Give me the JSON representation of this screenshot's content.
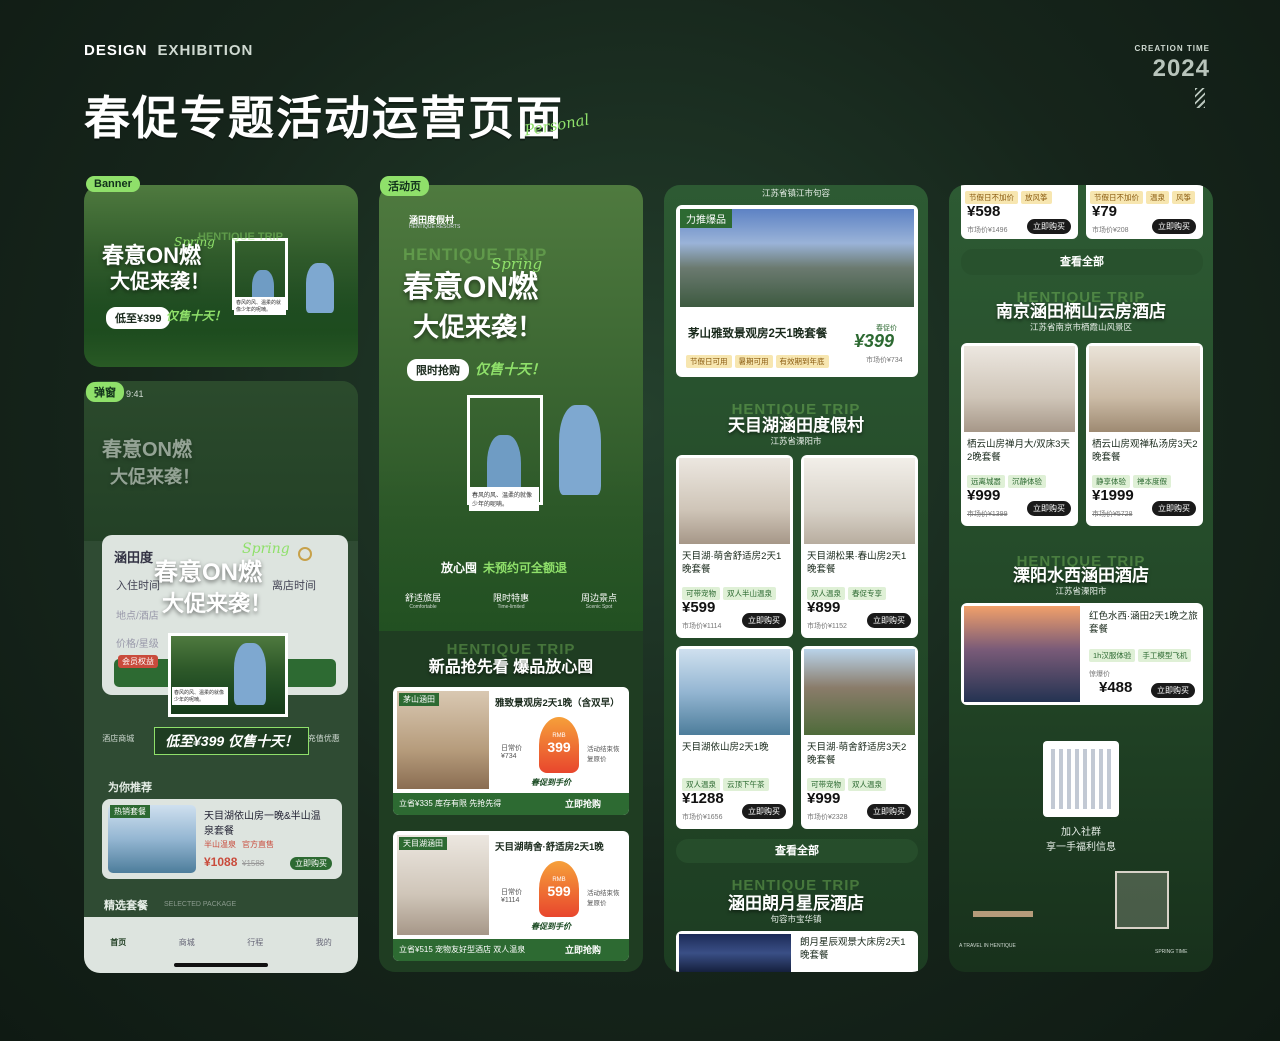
{
  "header": {
    "brand_a": "DESIGN",
    "brand_b": "EXHIBITION",
    "title": "春促专题活动运营页面",
    "script": "Personal",
    "creation_label": "CREATION TIME",
    "year": "2024"
  },
  "tags": {
    "banner": "Banner",
    "popup": "弹窗",
    "activity": "活动页"
  },
  "banner": {
    "trip": "HENTIQUE TRIP",
    "spring": "Spring",
    "line1": "春意ON燃",
    "line2": "大促来袭！",
    "price_pill": "低至¥399",
    "sale": "仅售十天！",
    "note": "春风的风、温柔的就像少年的呢喃。"
  },
  "popup": {
    "time": "9:41",
    "brand_row": "涵田度",
    "checkin": "入住时间",
    "checkout": "离店时间",
    "loc": "地点/酒店",
    "price": "价格/星级",
    "member": "会员权益",
    "icons": [
      "酒店商城",
      "加入社群",
      "最全攻略",
      "充值优惠"
    ],
    "rec_title": "为你推荐",
    "rec_tag": "热销套餐",
    "rec_name": "天目湖依山房一晚&半山温泉套餐",
    "rec_chips": [
      "半山温泉",
      "官方直售"
    ],
    "rec_price": "¥1088",
    "rec_old": "¥1588",
    "rec_buy": "立即购买",
    "pkg_title": "精选套餐",
    "pkg_en": "SELECTED PACKAGE",
    "nav": [
      "首页",
      "商城",
      "行程",
      "我的"
    ],
    "popup_price": "低至¥399 仅售十天！"
  },
  "activity": {
    "logo": "涵田度假村",
    "logo_en": "HENTIQUE RESORTS",
    "trip": "HENTIQUE TRIP",
    "spring": "Spring",
    "line1": "春意ON燃",
    "line2": "大促来袭！",
    "limited": "限时抢购",
    "sale": "仅售十天！",
    "note": "春风的风、温柔的就像少年的呢喃。",
    "slogan_a": "放心囤",
    "slogan_b": "未预约可全额退",
    "features": [
      {
        "zh": "舒适旅居",
        "en": "Comfortable"
      },
      {
        "zh": "限时特惠",
        "en": "Time-limited"
      },
      {
        "zh": "周边景点",
        "en": "Scenic Spot"
      }
    ],
    "new_title": "新品抢先看 爆品放心囤",
    "ghost": "HENTIQUE TRIP",
    "offers": [
      {
        "tag": "茅山涵田",
        "name": "雅致景观房2天1晚（含双早）",
        "daily": "日常价",
        "daily_val": "¥734",
        "rmb": "RMB",
        "price": "399",
        "end": "活动结束恢复原价",
        "hint": "春促到手价",
        "foot": "立省¥335 库存有限 先抢先得",
        "btn": "立即抢购"
      },
      {
        "tag": "天目湖涵田",
        "name": "天目湖萌舍·舒适房2天1晚",
        "daily": "日常价",
        "daily_val": "¥1114",
        "rmb": "RMB",
        "price": "599",
        "end": "活动结束恢复原价",
        "hint": "春促到手价",
        "foot": "立省¥515 宠物友好型酒店 双人温泉",
        "btn": "立即抢购"
      }
    ]
  },
  "col3": {
    "top_loc": "江苏省镇江市句容",
    "hot_tag": "力推爆品",
    "hot_name": "茅山雅致景观房2天1晚套餐",
    "hot_chips": [
      "节假日可用",
      "暑期可用",
      "有效期到年底"
    ],
    "spring_price_label": "春促价",
    "hot_price": "¥399",
    "hot_mk": "市场价¥734",
    "sec1_title": "天目湖涵田度假村",
    "sec1_loc": "江苏省溧阳市",
    "sec1_items": [
      {
        "name": "天目湖·萌舍舒适房2天1晚套餐",
        "chips": [
          "可带宠物",
          "双人半山温泉"
        ],
        "price": "¥599",
        "mk": "市场价¥1114",
        "buy": "立即购买"
      },
      {
        "name": "天目湖松果·春山房2天1晚套餐",
        "chips": [
          "双人温泉",
          "春促专享"
        ],
        "price": "¥899",
        "mk": "市场价¥1152",
        "buy": "立即购买"
      },
      {
        "name": "天目湖依山房2天1晚",
        "chips": [
          "双人温泉",
          "云顶下午茶"
        ],
        "price": "¥1288",
        "mk": "市场价¥1656",
        "buy": "立即购买"
      },
      {
        "name": "天目湖·萌舍舒适房3天2晚套餐",
        "chips": [
          "可带宠物",
          "双人温泉"
        ],
        "price": "¥999",
        "mk": "市场价¥2328",
        "buy": "立即购买"
      }
    ],
    "view_all": "查看全部",
    "sec2_title": "涵田朗月星辰酒店",
    "sec2_loc": "句容市宝华镇",
    "sec2_item": "朗月星辰观景大床房2天1晚套餐"
  },
  "col4": {
    "top_items": [
      {
        "chips": [
          "节假日不加价",
          "放风筝"
        ],
        "price": "¥598",
        "mk": "市场价¥1496",
        "buy": "立即购买"
      },
      {
        "chips": [
          "节假日不加价",
          "温泉",
          "风筝"
        ],
        "price": "¥79",
        "mk": "市场价¥208",
        "buy": "立即购买"
      }
    ],
    "view_all": "查看全部",
    "sec1_title": "南京涵田栖山云房酒店",
    "sec1_loc": "江苏省南京市栖霞山风景区",
    "sec1_items": [
      {
        "name": "栖云山房禅月大/双床3天2晚套餐",
        "chips": [
          "远离城嚣",
          "沉静体验"
        ],
        "price": "¥999",
        "mk": "市场价¥1399",
        "buy": "立即购买"
      },
      {
        "name": "栖云山房观禅私汤房3天2晚套餐",
        "chips": [
          "静享体验",
          "禅本度假"
        ],
        "price": "¥1999",
        "mk": "市场价¥5728",
        "buy": "立即购买"
      }
    ],
    "sec2_title": "溧阳水西涵田酒店",
    "sec2_loc": "江苏省溧阳市",
    "sec2_item": {
      "name": "红色水西·涵田2天1晚之旅套餐",
      "chips": [
        "1h汉服体验",
        "手工模型飞机"
      ],
      "label": "惊爆价",
      "price": "¥488",
      "buy": "立即购买"
    },
    "qr_a": "加入社群",
    "qr_b": "享一手福利信息",
    "foot_l": "A TRAVEL IN HENTIQUE",
    "foot_r": "SPRING TIME"
  }
}
